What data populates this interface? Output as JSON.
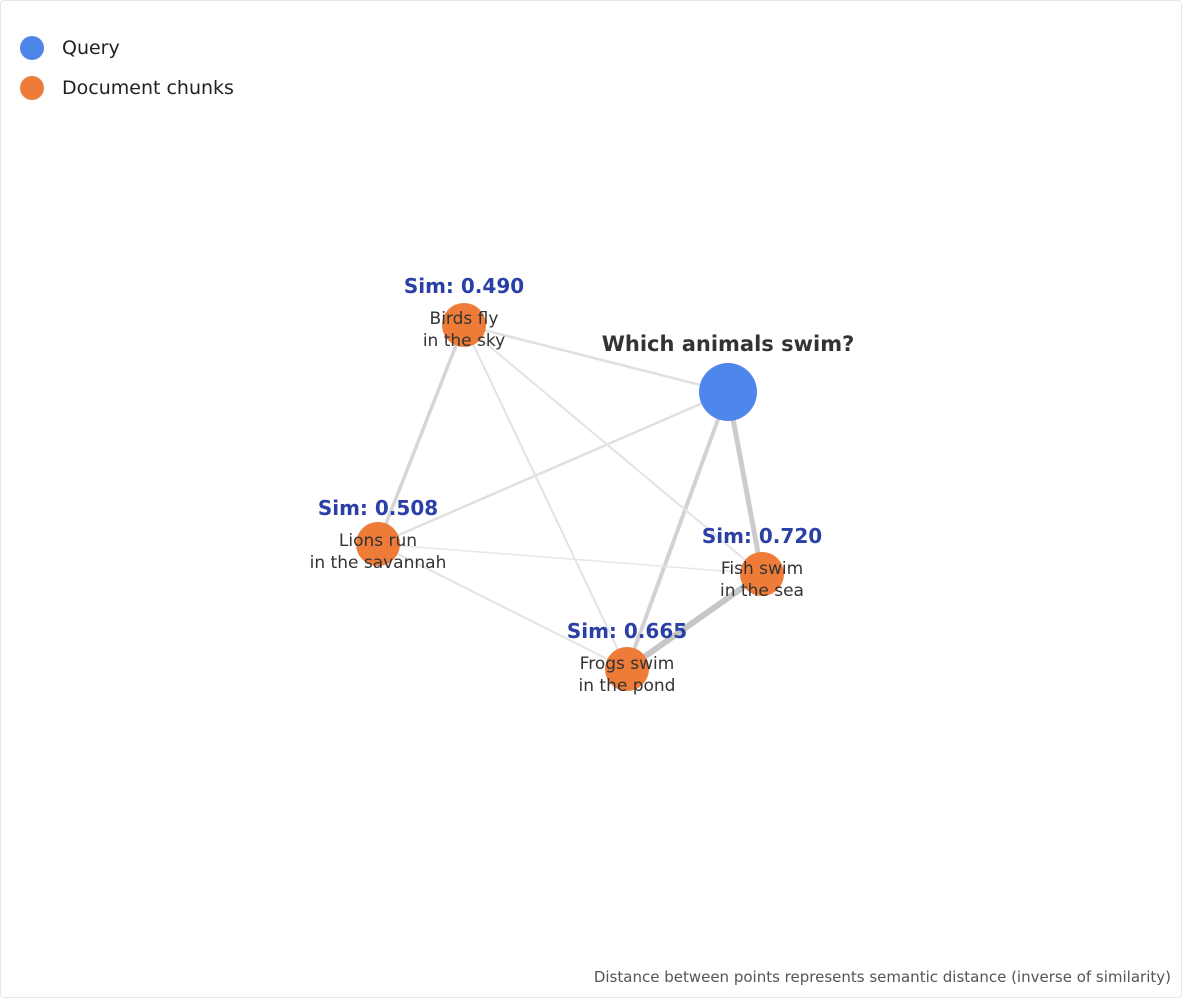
{
  "legend": {
    "items": [
      {
        "label": "Query",
        "color": "#4f86ec"
      },
      {
        "label": "Document chunks",
        "color": "#ee7b37"
      }
    ]
  },
  "query": {
    "label": "Which animals swim?",
    "color": "#4f86ec"
  },
  "documents": [
    {
      "line1": "Birds fly",
      "line2": "in the sky",
      "similarity": "Sim: 0.490"
    },
    {
      "line1": "Lions run",
      "line2": "in the savannah",
      "similarity": "Sim: 0.508"
    },
    {
      "line1": "Fish swim",
      "line2": "in the sea",
      "similarity": "Sim: 0.720"
    },
    {
      "line1": "Frogs swim",
      "line2": "in the pond",
      "similarity": "Sim: 0.665"
    }
  ],
  "colors": {
    "document": "#ee7b37",
    "similarity_label": "#2b40a6",
    "edge": "#d6d6d6",
    "text": "#333333"
  },
  "footnote": "Distance between points represents semantic distance (inverse of similarity)"
}
